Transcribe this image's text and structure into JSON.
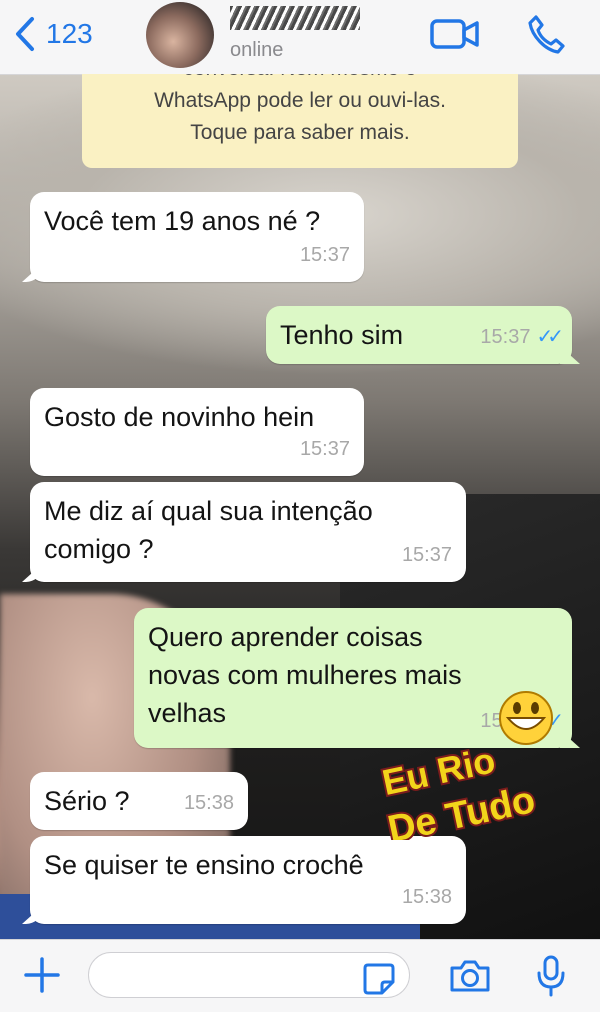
{
  "header": {
    "back_count": "123",
    "status": "online"
  },
  "notice": {
    "line0": "conversa. Nem mesmo o",
    "line1": "WhatsApp pode ler ou ouvi-las.",
    "line2": "Toque para saber mais."
  },
  "messages": [
    {
      "direction": "in",
      "line1": "Você tem 19 anos né ?",
      "time": "15:37"
    },
    {
      "direction": "out",
      "line1": "Tenho sim",
      "time": "15:37",
      "read": true
    },
    {
      "direction": "in",
      "line1": "Gosto de novinho hein",
      "time": "15:37"
    },
    {
      "direction": "in",
      "line1": "Me diz aí qual sua intenção",
      "line2": "comigo ?",
      "time": "15:37"
    },
    {
      "direction": "out",
      "line1": "Quero aprender coisas",
      "line2": "novas com mulheres mais",
      "line3": "velhas",
      "time": "15:37",
      "read": true
    },
    {
      "direction": "in",
      "line1": "Sério ?",
      "time": "15:38"
    },
    {
      "direction": "in",
      "line1": "Se quiser te ensino crochê",
      "time": "15:38"
    }
  ],
  "watermark": {
    "line1": "Eu Rio",
    "line2": "De Tudo"
  },
  "icons": {
    "back": "chevron-left-icon",
    "video": "video-camera-icon",
    "call": "phone-icon",
    "plus": "plus-icon",
    "sticker": "sticker-icon",
    "camera": "camera-icon",
    "mic": "microphone-icon"
  },
  "colors": {
    "accent": "#2277e6",
    "outgoing_bubble": "#dcf8c6",
    "incoming_bubble": "#ffffff",
    "notice": "#faf1c3",
    "read_ticks": "#3497f9"
  }
}
